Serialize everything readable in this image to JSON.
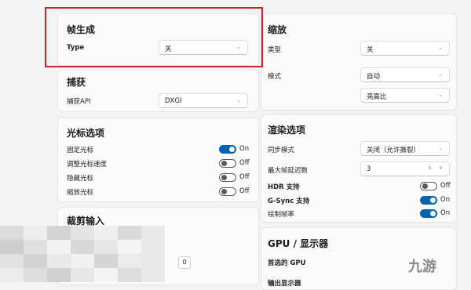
{
  "frame_gen": {
    "title": "帧生成",
    "type_label": "Type",
    "type_value": "关"
  },
  "capture": {
    "title": "捕获",
    "api_label": "捕获API",
    "api_value": "DXGI"
  },
  "cursor": {
    "title": "光标选项",
    "items": [
      {
        "label": "固定光标",
        "state": "On",
        "on": true
      },
      {
        "label": "调整光标速度",
        "state": "Off",
        "on": false
      },
      {
        "label": "隐藏光标",
        "state": "Off",
        "on": false
      },
      {
        "label": "缩放光标",
        "state": "Off",
        "on": false
      }
    ]
  },
  "crop": {
    "title": "裁剪输入",
    "val1": "0",
    "val2": "0"
  },
  "scaling": {
    "title": "缩放",
    "type_label": "类型",
    "type_value": "关",
    "mode_label": "模式",
    "mode_value": "自动",
    "mode_value2": "亮高比"
  },
  "render": {
    "title": "渲染选项",
    "vsync_label": "同步模式",
    "vsync_value": "关闭（允许撕裂）",
    "maxframes_label": "最大帧延迟数",
    "maxframes_value": "3",
    "hdr_label": "HDR 支持",
    "hdr_state": "Off",
    "gsync_label": "G-Sync 支持",
    "gsync_state": "On",
    "draw_label": "绘制帧率",
    "draw_state": "On"
  },
  "gpu": {
    "title": "GPU / 显示器",
    "preferred_label": "首选的 GPU",
    "output_label": "输出显示器"
  },
  "watermark": "九游",
  "icons": {
    "chevron": "chevron-down-icon",
    "spin": "spin-icon"
  }
}
